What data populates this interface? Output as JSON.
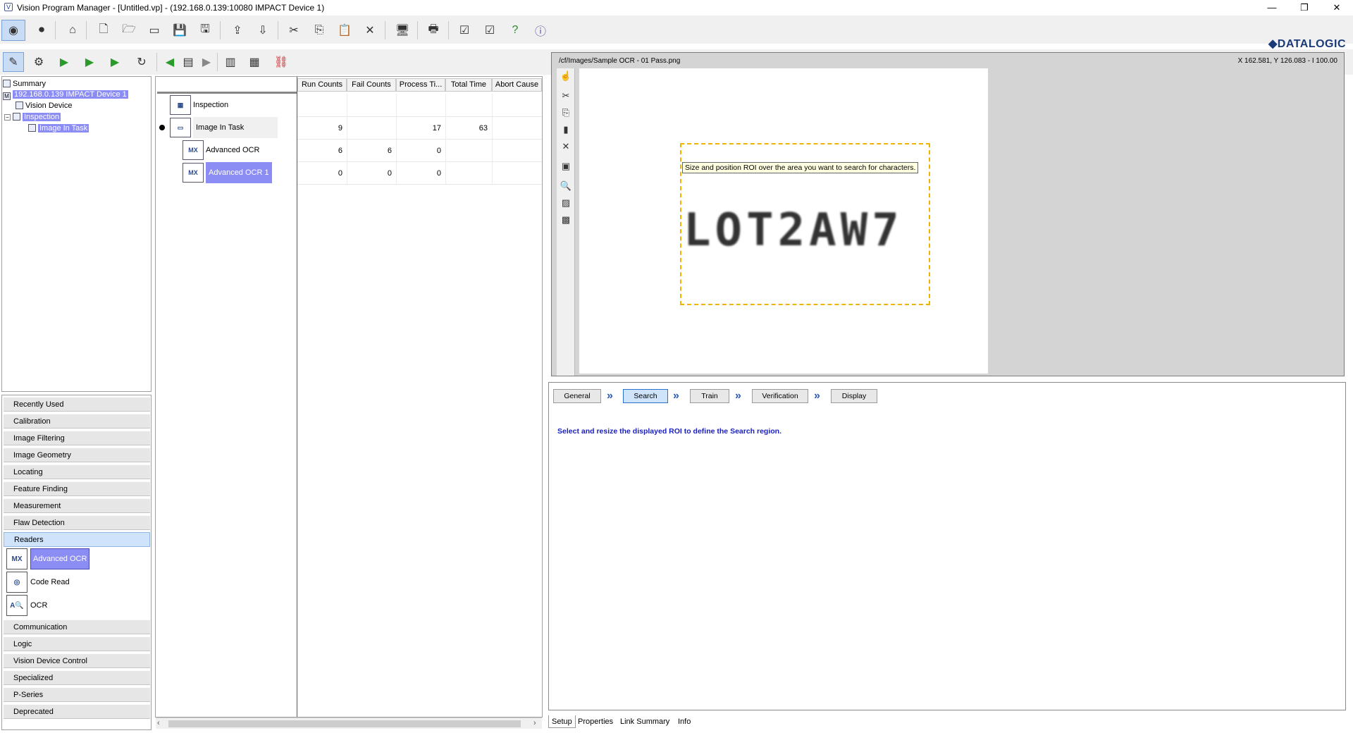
{
  "window": {
    "title": "Vision Program Manager - [Untitled.vp] - (192.168.0.139:10080 IMPACT Device 1)",
    "minimize": "—",
    "maximize": "❐",
    "close": "✕"
  },
  "brand": {
    "logo_text": "DATALOGIC",
    "logo_mark": "◆",
    "color": "#1a3a7a"
  },
  "tree": {
    "summary": "Summary",
    "device": "192.168.0.139 IMPACT Device 1",
    "vision_device": "Vision Device",
    "inspection": "Inspection",
    "image_in_task": "Image In Task",
    "collapse_glyph": "−"
  },
  "toolbox": {
    "categories": {
      "recently_used": "Recently Used",
      "calibration": "Calibration",
      "image_filtering": "Image Filtering",
      "image_geometry": "Image Geometry",
      "locating": "Locating",
      "feature_finding": "Feature Finding",
      "measurement": "Measurement",
      "flaw_detection": "Flaw Detection",
      "readers": "Readers",
      "communication": "Communication",
      "logic": "Logic",
      "vision_device_control": "Vision Device Control",
      "specialized": "Specialized",
      "p_series": "P-Series",
      "deprecated": "Deprecated"
    },
    "readers_tools": {
      "advanced_ocr": "Advanced OCR",
      "code_read": "Code Read",
      "ocr": "OCR"
    }
  },
  "grid": {
    "columns": [
      "Run Counts",
      "Fail Counts",
      "Process Ti...",
      "Total Time",
      "Abort Cause"
    ],
    "rows": [
      {
        "name": "Inspection",
        "run": "",
        "fail": "",
        "process": "",
        "total": ""
      },
      {
        "name": "Image In Task",
        "run": "9",
        "fail": "",
        "process": "17",
        "total": "63"
      },
      {
        "name": "Advanced OCR",
        "run": "6",
        "fail": "6",
        "process": "0",
        "total": ""
      },
      {
        "name": "Advanced OCR 1",
        "run": "0",
        "fail": "0",
        "process": "0",
        "total": ""
      }
    ]
  },
  "image_view": {
    "path": "/cf/Images/Sample OCR - 01 Pass.png",
    "coords": "X 162.581,  Y 126.083  -  I 100.00",
    "tooltip": "Size and position ROI over the area you want to search for characters.",
    "ocr_text": "LOT2AW7",
    "roi_color": "#f0b400"
  },
  "setup": {
    "steps": [
      "General",
      "Search",
      "Train",
      "Verification",
      "Display"
    ],
    "active_step": "Search",
    "instruction": "Select and resize the displayed ROI to define the Search region."
  },
  "bottom_tabs": [
    "Setup",
    "Properties",
    "Link Summary",
    "Info"
  ]
}
